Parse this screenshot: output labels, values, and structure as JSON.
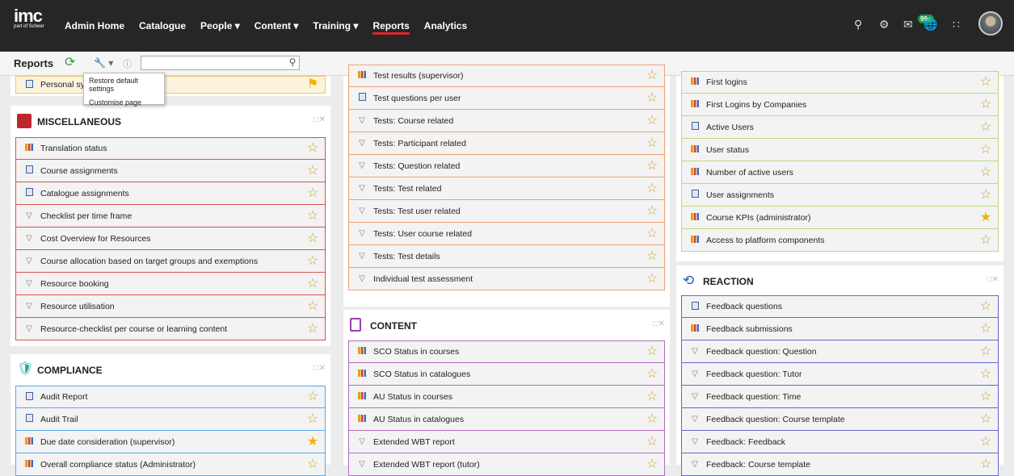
{
  "brand": {
    "name": "imc",
    "sub": "part of Scheer"
  },
  "nav": [
    {
      "label": "Admin Home"
    },
    {
      "label": "Catalogue"
    },
    {
      "label": "People ▾"
    },
    {
      "label": "Content ▾"
    },
    {
      "label": "Training ▾"
    },
    {
      "label": "Reports"
    },
    {
      "label": "Analytics"
    }
  ],
  "top": {
    "badge": "99+"
  },
  "toolbar": {
    "title": "Reports",
    "search_value": ""
  },
  "dropdown": [
    "Restore default settings",
    "Customise page"
  ],
  "col1": {
    "partial_row": "Personal syllabus …ary",
    "misc": {
      "title": "MISCELLANEOUS",
      "rows": [
        {
          "icon": "bar",
          "label": "Translation status",
          "fav": false
        },
        {
          "icon": "doc",
          "label": "Course assignments",
          "fav": false
        },
        {
          "icon": "doc",
          "label": "Catalogue assignments",
          "fav": false
        },
        {
          "icon": "fil",
          "label": "Checklist per time frame",
          "fav": false
        },
        {
          "icon": "fil",
          "label": "Cost Overview for Resources",
          "fav": false
        },
        {
          "icon": "fil",
          "label": "Course allocation based on target groups and exemptions",
          "fav": false
        },
        {
          "icon": "fil",
          "label": "Resource booking",
          "fav": false
        },
        {
          "icon": "fil",
          "label": "Resource utilisation",
          "fav": false
        },
        {
          "icon": "fil",
          "label": "Resource-checklist per course or learning content",
          "fav": false
        }
      ]
    },
    "compliance": {
      "title": "COMPLIANCE",
      "rows": [
        {
          "icon": "doc",
          "label": "Audit Report",
          "fav": false
        },
        {
          "icon": "doc",
          "label": "Audit Trail",
          "fav": false
        },
        {
          "icon": "bar",
          "label": "Due date consideration (supervisor)",
          "fav": true
        },
        {
          "icon": "bar",
          "label": "Overall compliance status (Administrator)",
          "fav": false
        }
      ]
    }
  },
  "col2": {
    "tests": {
      "rows": [
        {
          "icon": "bar",
          "label": "Test results (supervisor)",
          "fav": false
        },
        {
          "icon": "doc",
          "label": "Test questions per user",
          "fav": false
        },
        {
          "icon": "fil",
          "label": "Tests: Course related",
          "fav": false
        },
        {
          "icon": "fil",
          "label": "Tests: Participant related",
          "fav": false
        },
        {
          "icon": "fil",
          "label": "Tests: Question related",
          "fav": false
        },
        {
          "icon": "fil",
          "label": "Tests: Test related",
          "fav": false
        },
        {
          "icon": "fil",
          "label": "Tests: Test user related",
          "fav": false
        },
        {
          "icon": "fil",
          "label": "Tests: User course related",
          "fav": false
        },
        {
          "icon": "fil",
          "label": "Tests: Test details",
          "fav": false
        },
        {
          "icon": "fil",
          "label": "Individual test assessment",
          "fav": false
        }
      ]
    },
    "content": {
      "title": "CONTENT",
      "rows": [
        {
          "icon": "bar",
          "label": "SCO Status in courses",
          "fav": false
        },
        {
          "icon": "bar",
          "label": "SCO Status in catalogues",
          "fav": false
        },
        {
          "icon": "bar",
          "label": "AU Status in courses",
          "fav": false
        },
        {
          "icon": "bar",
          "label": "AU Status in catalogues",
          "fav": false
        },
        {
          "icon": "fil",
          "label": "Extended WBT report",
          "fav": false
        },
        {
          "icon": "fil",
          "label": "Extended WBT report (tutor)",
          "fav": false
        }
      ]
    }
  },
  "col3": {
    "users": {
      "rows": [
        {
          "icon": "bar",
          "label": "First logins",
          "fav": false
        },
        {
          "icon": "bar",
          "label": "First Logins by Companies",
          "fav": false
        },
        {
          "icon": "doc",
          "label": "Active Users",
          "fav": false
        },
        {
          "icon": "bar",
          "label": "User status",
          "fav": false
        },
        {
          "icon": "bar",
          "label": "Number of active users",
          "fav": false
        },
        {
          "icon": "doc",
          "label": "User assignments",
          "fav": false
        },
        {
          "icon": "bar",
          "label": "Course KPIs (administrator)",
          "fav": true
        },
        {
          "icon": "bar",
          "label": "Access to platform components",
          "fav": false
        }
      ]
    },
    "reaction": {
      "title": "REACTION",
      "rows": [
        {
          "icon": "doc",
          "label": "Feedback questions",
          "fav": false
        },
        {
          "icon": "bar",
          "label": "Feedback submissions",
          "fav": false
        },
        {
          "icon": "fil",
          "label": "Feedback question: Question",
          "fav": false
        },
        {
          "icon": "fil",
          "label": "Feedback question: Tutor",
          "fav": false
        },
        {
          "icon": "fil",
          "label": "Feedback question: Time",
          "fav": false
        },
        {
          "icon": "fil",
          "label": "Feedback question: Course template",
          "fav": false
        },
        {
          "icon": "fil",
          "label": "Feedback: Feedback",
          "fav": false
        },
        {
          "icon": "fil",
          "label": "Feedback: Course template",
          "fav": false
        }
      ]
    }
  }
}
